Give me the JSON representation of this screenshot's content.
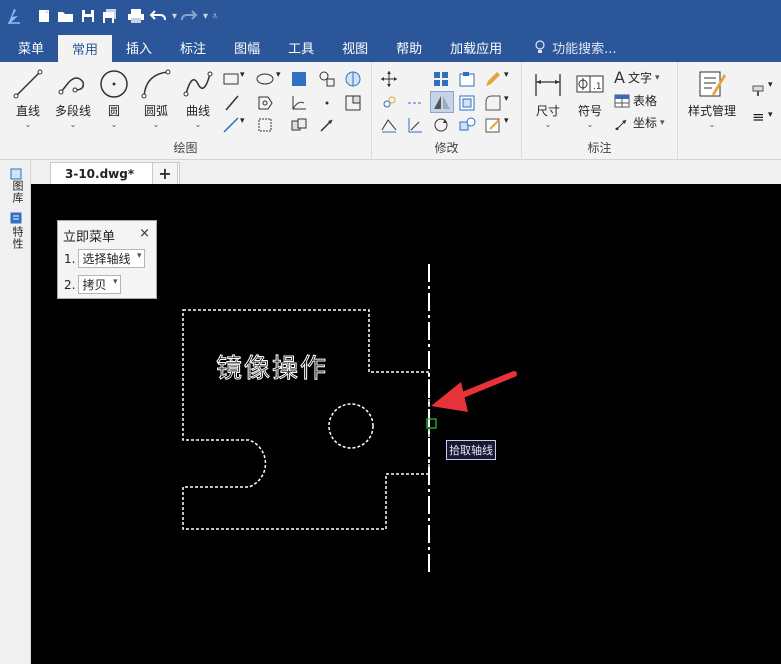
{
  "ribbon_tabs": {
    "menu": "菜单",
    "common": "常用",
    "insert": "插入",
    "dimension": "标注",
    "layout": "图幅",
    "tools": "工具",
    "view": "视图",
    "help": "帮助",
    "addins": "加载应用",
    "search_placeholder": "功能搜索..."
  },
  "draw_group": {
    "title": "绘图",
    "line": "直线",
    "polyline": "多段线",
    "circle": "圆",
    "arc": "圆弧",
    "curve": "曲线"
  },
  "modify_group": {
    "title": "修改"
  },
  "annotate_group": {
    "title": "标注",
    "dimension": "尺寸",
    "symbol": "符号",
    "text": "文字",
    "table": "表格",
    "coordinate": "坐标",
    "style_manager": "样式管理"
  },
  "document_tab": {
    "name": "3-10.dwg*",
    "close": "×",
    "new": "+"
  },
  "side_palette": {
    "library": "图库",
    "properties": "特性"
  },
  "immediate_menu": {
    "title": "立即菜单",
    "close": "×",
    "row1_index": "1.",
    "row1_value": "选择轴线",
    "row2_index": "2.",
    "row2_value": "拷贝"
  },
  "canvas": {
    "drawing_text": "镜像操作",
    "tooltip": "拾取轴线"
  },
  "colors": {
    "titlebar": "#2b579a",
    "ribbon": "#f3f3f3",
    "canvas": "#000000",
    "arrow": "#e8323a"
  }
}
